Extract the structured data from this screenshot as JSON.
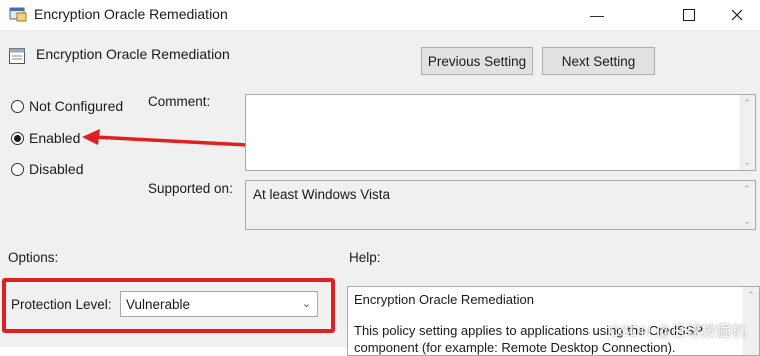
{
  "window": {
    "title": "Encryption Oracle Remediation",
    "controls": [
      "minimize-icon",
      "maximize-icon",
      "close-icon"
    ]
  },
  "header": {
    "setting_name": "Encryption Oracle Remediation",
    "prev_label": "Previous Setting",
    "next_label": "Next Setting"
  },
  "state": {
    "options": [
      {
        "label": "Not Configured",
        "selected": false
      },
      {
        "label": "Enabled",
        "selected": true
      },
      {
        "label": "Disabled",
        "selected": false
      }
    ]
  },
  "comment": {
    "label": "Comment:",
    "value": ""
  },
  "supported": {
    "label": "Supported on:",
    "value": "At least Windows Vista"
  },
  "options_section": {
    "label": "Options:",
    "protection_level_label": "Protection Level:",
    "protection_level_value": "Vulnerable"
  },
  "help": {
    "label": "Help:",
    "line1": "Encryption Oracle Remediation",
    "line2": "This policy setting applies to applications using the CredSSP",
    "line3": "component (for example: Remote Desktop Connection)."
  },
  "watermark": "CSDN @日球按掘机",
  "colors": {
    "annotation_red": "#e02020",
    "panel_bg": "#f0f0f0"
  }
}
